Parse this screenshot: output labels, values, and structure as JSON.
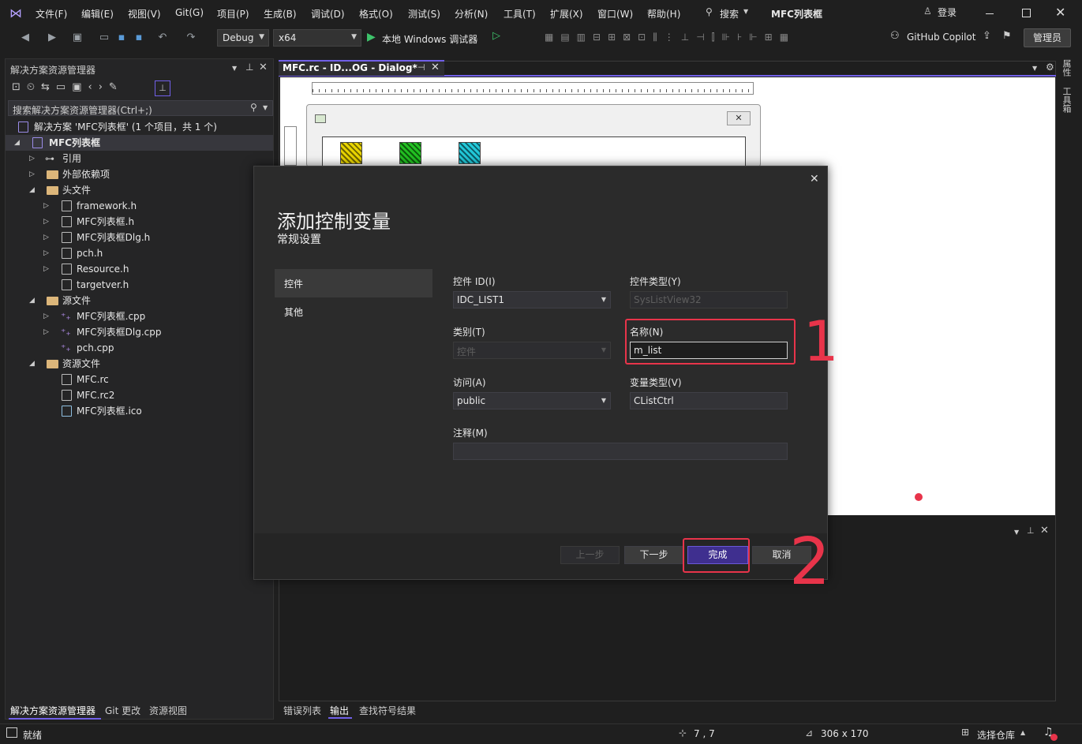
{
  "menu": [
    "文件(F)",
    "编辑(E)",
    "视图(V)",
    "Git(G)",
    "项目(P)",
    "生成(B)",
    "调试(D)",
    "格式(O)",
    "测试(S)",
    "分析(N)",
    "工具(T)",
    "扩展(X)",
    "窗口(W)",
    "帮助(H)"
  ],
  "search_label": "搜索",
  "solution_name": "MFC列表框",
  "login_label": "登录",
  "toolbar": {
    "config": "Debug",
    "platform": "x64",
    "run_label": "本地 Windows 调试器",
    "copilot": "GitHub Copilot",
    "admin": "管理员"
  },
  "solution_explorer": {
    "title": "解决方案资源管理器",
    "search_placeholder": "搜索解决方案资源管理器(Ctrl+;)",
    "solution_row": "解决方案 'MFC列表框' (1 个项目，共 1 个)",
    "project": "MFC列表框",
    "items": [
      {
        "label": "引用"
      },
      {
        "label": "外部依赖项"
      },
      {
        "label": "头文件"
      },
      {
        "label": "framework.h"
      },
      {
        "label": "MFC列表框.h"
      },
      {
        "label": "MFC列表框Dlg.h"
      },
      {
        "label": "pch.h"
      },
      {
        "label": "Resource.h"
      },
      {
        "label": "targetver.h"
      },
      {
        "label": "源文件"
      },
      {
        "label": "MFC列表框.cpp"
      },
      {
        "label": "MFC列表框Dlg.cpp"
      },
      {
        "label": "pch.cpp"
      },
      {
        "label": "资源文件"
      },
      {
        "label": "MFC.rc"
      },
      {
        "label": "MFC.rc2"
      },
      {
        "label": "MFC列表框.ico"
      }
    ],
    "bottom_tabs": [
      "解决方案资源管理器",
      "Git 更改",
      "资源视图"
    ]
  },
  "editor": {
    "tab_label": "MFC.rc - ID...OG - Dialog*"
  },
  "right_rail": [
    "属性",
    "工具箱"
  ],
  "output_tabs": [
    "错误列表",
    "输出",
    "查找符号结果"
  ],
  "dialog": {
    "title": "添加控制变量",
    "subtitle": "常规设置",
    "nav": [
      "控件",
      "其他"
    ],
    "fields": {
      "control_id_label": "控件 ID(I)",
      "control_id_value": "IDC_LIST1",
      "control_type_label": "控件类型(Y)",
      "control_type_value": "SysListView32",
      "category_label": "类别(T)",
      "category_value": "控件",
      "name_label": "名称(N)",
      "name_value": "m_list",
      "access_label": "访问(A)",
      "access_value": "public",
      "var_type_label": "变量类型(V)",
      "var_type_value": "CListCtrl",
      "comment_label": "注释(M)",
      "comment_value": ""
    },
    "buttons": {
      "prev": "上一步",
      "next": "下一步",
      "finish": "完成",
      "cancel": "取消"
    }
  },
  "annotations": {
    "mark_1": "1",
    "mark_2": "2",
    "color": "#e8344a"
  },
  "status_bar": {
    "ready": "就绪",
    "position": "7 , 7",
    "size": "306 x 170",
    "repo": "选择仓库"
  },
  "colors": {
    "accent": "#7160e8",
    "finish_bg": "#3f2f8f",
    "highlight_red": "#e8344a"
  }
}
